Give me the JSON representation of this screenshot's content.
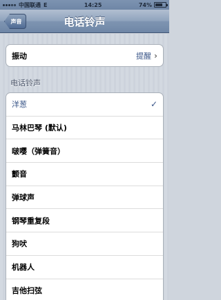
{
  "status_bar": {
    "carrier": "中国联通",
    "network": "E",
    "time": "14:25",
    "battery": "74%",
    "battery_level": 0.74
  },
  "nav": {
    "back_label": "声音",
    "title": "电话铃声"
  },
  "vibrate": {
    "label": "振动",
    "value": "提醒"
  },
  "section_header": "电话铃声",
  "ringtones": [
    {
      "label": "洋葱",
      "selected": true
    },
    {
      "label": "马林巴琴 (默认)",
      "selected": false
    },
    {
      "label": "啵嘤（弹簧音）",
      "selected": false
    },
    {
      "label": "颤音",
      "selected": false
    },
    {
      "label": "弹球声",
      "selected": false
    },
    {
      "label": "钢琴重复段",
      "selected": false
    },
    {
      "label": "狗吠",
      "selected": false
    },
    {
      "label": "机器人",
      "selected": false
    },
    {
      "label": "吉他扫弦",
      "selected": false
    }
  ],
  "colors": {
    "accent": "#385487",
    "nav_bar": "#7f95b2"
  }
}
